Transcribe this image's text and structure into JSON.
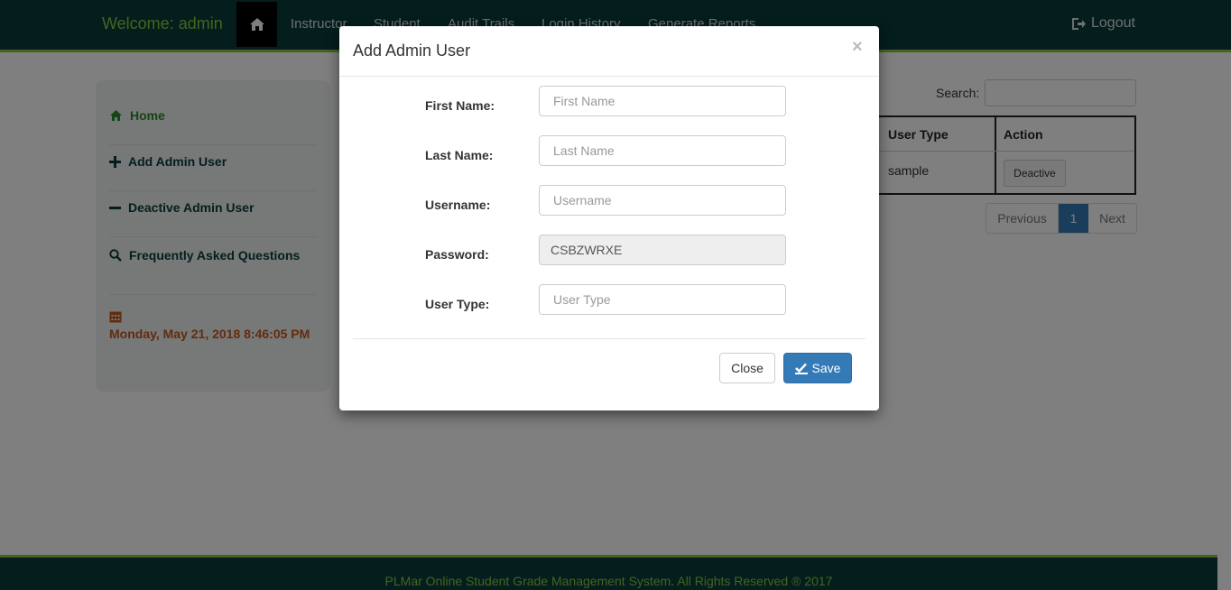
{
  "navbar": {
    "welcome": "Welcome: admin",
    "home_icon": "home-icon",
    "items": [
      "Instructor",
      "Student",
      "Audit Trails",
      "Login History",
      "Generate Reports"
    ],
    "logout": "Logout",
    "logout_icon": "logout-icon"
  },
  "sidebar": {
    "home": "Home",
    "add_admin": "Add Admin User",
    "deactive_admin": "Deactive Admin User",
    "faq": "Frequently Asked Questions",
    "datetime": "Monday, May 21, 2018 8:46:05 PM"
  },
  "content": {
    "search_label": "Search:",
    "table": {
      "headers": [
        "User Type",
        "Action"
      ],
      "rows": [
        {
          "user_type": "sample",
          "action": "Deactive"
        }
      ]
    },
    "pagination": {
      "previous": "Previous",
      "current": "1",
      "next": "Next"
    }
  },
  "modal": {
    "title": "Add Admin User",
    "close_x": "×",
    "fields": {
      "first_name": {
        "label": "First Name:",
        "placeholder": "First Name",
        "value": ""
      },
      "last_name": {
        "label": "Last Name:",
        "placeholder": "Last Name",
        "value": ""
      },
      "username": {
        "label": "Username:",
        "placeholder": "Username",
        "value": ""
      },
      "password": {
        "label": "Password:",
        "placeholder": "",
        "value": "CSBZWRXE"
      },
      "user_type": {
        "label": "User Type:",
        "placeholder": "User Type",
        "value": ""
      }
    },
    "close_button": "Close",
    "save_button": "Save"
  },
  "footer": {
    "text": "PLMar Online Student Grade Management System. All Rights Reserved ® 2017"
  },
  "colors": {
    "navbar_bg": "#083d3a",
    "accent_green": "#8dc63f",
    "primary_blue": "#337ab7",
    "date_orange": "#c25a1c"
  }
}
